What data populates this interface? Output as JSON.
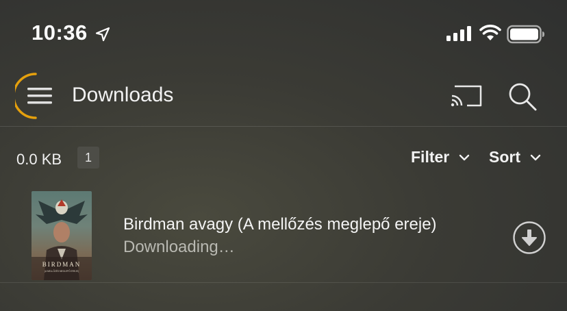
{
  "status_bar": {
    "time": "10:36",
    "icons": [
      "location-arrow-icon",
      "cellular-signal-icon",
      "wifi-icon",
      "battery-icon"
    ]
  },
  "toolbar": {
    "title": "Downloads",
    "icons": [
      "menu-icon",
      "cast-icon",
      "search-icon"
    ],
    "accent_color": "#e5a00d"
  },
  "summary": {
    "size": "0.0 KB",
    "count": "1",
    "filter_label": "Filter",
    "sort_label": "Sort"
  },
  "downloads": [
    {
      "title": "Birdman avagy (A mellőzés meglepő ereje)",
      "status": "Downloading…",
      "poster_text": "BIRDMAN",
      "poster_subtext": "(A MELLŐZÉS MEGLEPŐ EREJE)",
      "action_icon": "download-arrow-icon"
    }
  ]
}
